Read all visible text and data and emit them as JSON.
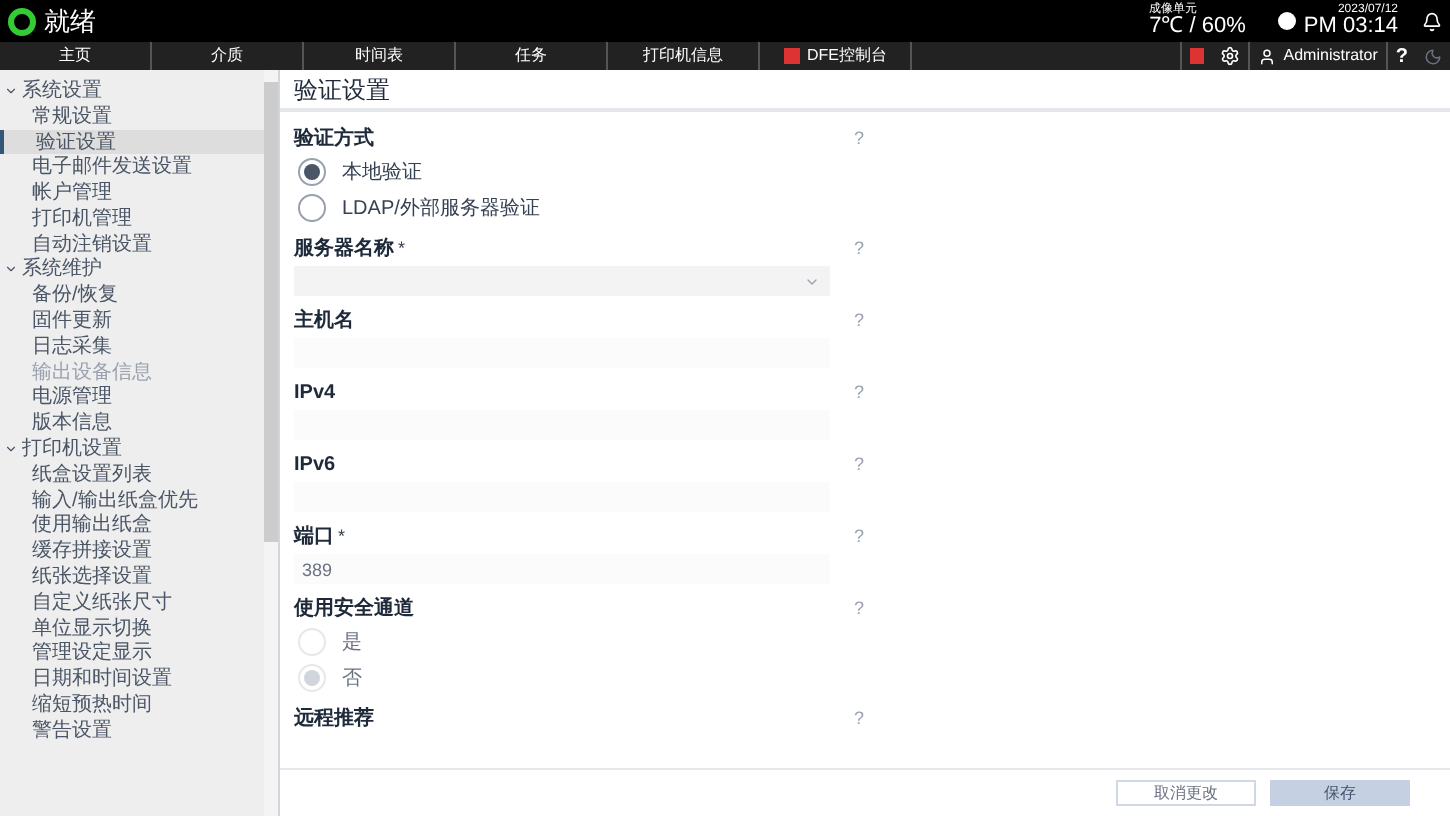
{
  "header": {
    "status": "就绪",
    "sensor_label": "成像单元",
    "climate": "7℃ / 60%",
    "date": "2023/07/12",
    "time": "PM 03:14",
    "user": "Administrator",
    "help": "?"
  },
  "nav_tabs": [
    {
      "label": "主页",
      "selected": false
    },
    {
      "label": "介质",
      "selected": false
    },
    {
      "label": "时间表",
      "selected": false
    },
    {
      "label": "任务",
      "selected": false
    },
    {
      "label": "打印机信息",
      "selected": false
    },
    {
      "label": "DFE控制台",
      "selected": false,
      "kind": "app"
    }
  ],
  "sidebar": {
    "items": [
      {
        "label": "系统设置",
        "expanded": true,
        "children": [
          {
            "label": "常规设置",
            "selected": false,
            "disabled": false
          },
          {
            "label": "验证设置",
            "selected": true,
            "disabled": false
          },
          {
            "label": "电子邮件发送设置",
            "selected": false,
            "disabled": false
          },
          {
            "label": "帐户管理",
            "selected": false,
            "disabled": false
          },
          {
            "label": "打印机管理",
            "selected": false,
            "disabled": false
          },
          {
            "label": "自动注销设置",
            "selected": false,
            "disabled": false
          }
        ]
      },
      {
        "label": "系统维护",
        "expanded": true,
        "children": [
          {
            "label": "备份/恢复",
            "selected": false,
            "disabled": false
          },
          {
            "label": "固件更新",
            "selected": false,
            "disabled": false
          },
          {
            "label": "日志采集",
            "selected": false,
            "disabled": false
          },
          {
            "label": "输出设备信息",
            "selected": false,
            "disabled": true
          },
          {
            "label": "电源管理",
            "selected": false,
            "disabled": false
          },
          {
            "label": "版本信息",
            "selected": false,
            "disabled": false
          }
        ]
      },
      {
        "label": "打印机设置",
        "expanded": true,
        "children": [
          {
            "label": "纸盒设置列表",
            "selected": false,
            "disabled": false
          },
          {
            "label": "输入/输出纸盒优先",
            "selected": false,
            "disabled": false
          },
          {
            "label": "使用输出纸盒",
            "selected": false,
            "disabled": false
          },
          {
            "label": "缓存拼接设置",
            "selected": false,
            "disabled": false
          },
          {
            "label": "纸张选择设置",
            "selected": false,
            "disabled": false
          },
          {
            "label": "自定义纸张尺寸",
            "selected": false,
            "disabled": false
          },
          {
            "label": "单位显示切换",
            "selected": false,
            "disabled": false
          },
          {
            "label": "管理设定显示",
            "selected": false,
            "disabled": false
          },
          {
            "label": "日期和时间设置",
            "selected": false,
            "disabled": false
          },
          {
            "label": "缩短预热时间",
            "selected": false,
            "disabled": false
          },
          {
            "label": "警告设置",
            "selected": false,
            "disabled": false
          }
        ]
      }
    ]
  },
  "page": {
    "title": "验证设置",
    "help": "?",
    "sections": [
      {
        "kind": "radio",
        "label": "验证方式",
        "options": [
          {
            "label": "本地验证",
            "selected": true,
            "disabled": false
          },
          {
            "label": "LDAP/外部服务器验证",
            "selected": false,
            "disabled": false
          }
        ]
      },
      {
        "kind": "select",
        "label": "服务器名称",
        "marker": "*"
      },
      {
        "kind": "text",
        "label": "主机名"
      },
      {
        "kind": "text",
        "label": "IPv4"
      },
      {
        "kind": "text",
        "label": "IPv6"
      },
      {
        "kind": "text",
        "label": "端口",
        "marker": "*",
        "placeholder": "389"
      },
      {
        "kind": "radio",
        "label": "使用安全通道",
        "options": [
          {
            "label": "是",
            "selected": false,
            "disabled": true
          },
          {
            "label": "否",
            "selected": true,
            "disabled": true
          }
        ]
      },
      {
        "kind": "radio",
        "label": "远程推荐"
      }
    ]
  },
  "footer": {
    "buttons": [
      {
        "label": "取消更改",
        "kind": "secondary",
        "disabled": true
      },
      {
        "label": "保存",
        "kind": "primary",
        "disabled": true
      }
    ]
  }
}
